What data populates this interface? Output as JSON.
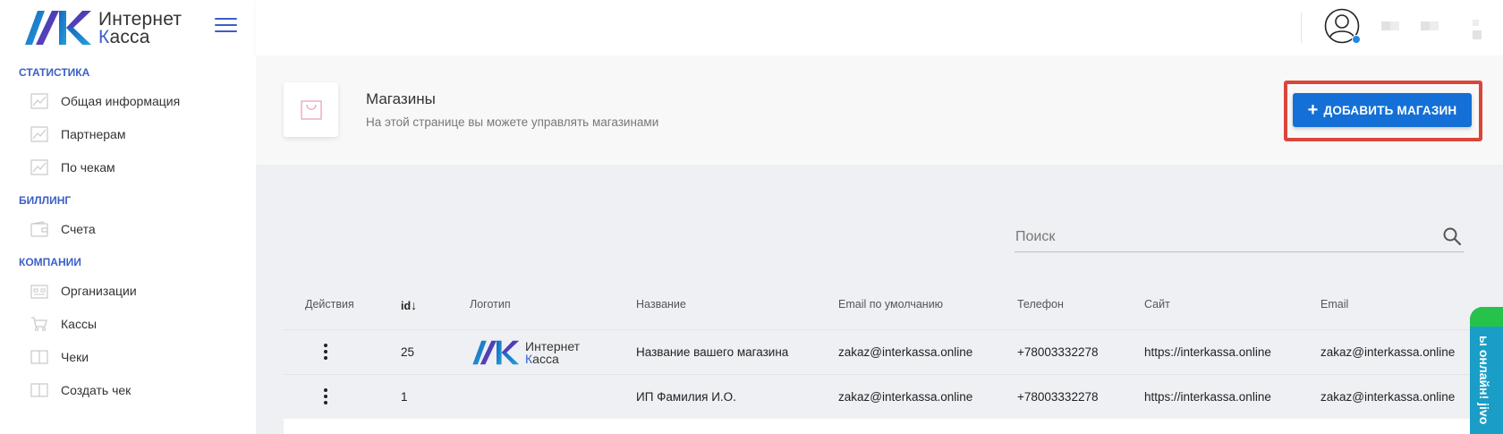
{
  "brand": {
    "line1": "Интернет",
    "line2_accent": "К",
    "line2_rest": "асса"
  },
  "sidebar": {
    "sections": [
      {
        "title": "СТАТИСТИКА",
        "items": [
          {
            "label": "Общая информация",
            "icon": "chart-icon"
          },
          {
            "label": "Партнерам",
            "icon": "chart-icon"
          },
          {
            "label": "По чекам",
            "icon": "chart-icon"
          }
        ]
      },
      {
        "title": "БИЛЛИНГ",
        "items": [
          {
            "label": "Счета",
            "icon": "wallet-icon"
          }
        ]
      },
      {
        "title": "КОМПАНИИ",
        "items": [
          {
            "label": "Организации",
            "icon": "organization-icon"
          },
          {
            "label": "Кассы",
            "icon": "cart-icon"
          },
          {
            "label": "Чеки",
            "icon": "book-icon"
          },
          {
            "label": "Создать чек",
            "icon": "book-icon"
          }
        ]
      }
    ]
  },
  "header": {
    "title": "Магазины",
    "subtitle": "На этой странице вы можете управлять магазинами",
    "add_button": "ДОБАВИТЬ МАГАЗИН",
    "add_icon": "+"
  },
  "search": {
    "placeholder": "Поиск"
  },
  "table": {
    "columns": [
      "Действия",
      "id",
      "Логотип",
      "Название",
      "Email по умолчанию",
      "Телефон",
      "Сайт",
      "Email"
    ],
    "sort_indicator": "↓",
    "rows": [
      {
        "id": "25",
        "has_logo": true,
        "name": "Название вашего магазина",
        "default_email": "zakaz@interkassa.online",
        "phone": "+78003332278",
        "site": "https://interkassa.online",
        "email": "zakaz@interkassa.online"
      },
      {
        "id": "1",
        "has_logo": false,
        "name": "ИП Фамилия И.О.",
        "default_email": "zakaz@interkassa.online",
        "phone": "+78003332278",
        "site": "https://interkassa.online",
        "email": "zakaz@interkassa.online"
      }
    ]
  },
  "chat_widget": {
    "label": "ы онлайн! jivo"
  },
  "colors": {
    "accent": "#3b5fc6",
    "button": "#1470d6",
    "highlight": "#d9463a",
    "chat": "#1a9ec7",
    "chat_top": "#27c24c"
  }
}
